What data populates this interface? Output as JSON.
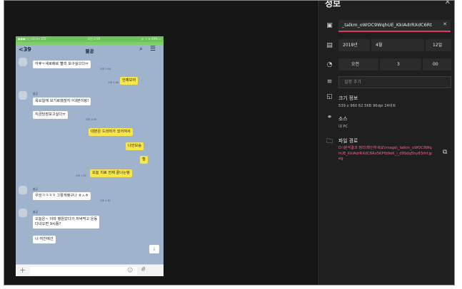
{
  "panel": {
    "title": "정보",
    "close_icon": "✕",
    "filename": "_talkm_oWOC9WqhUE_KkIAdrRXdC6Rt",
    "date": {
      "year": "2018년",
      "month": "4월",
      "day": "12일"
    },
    "time": {
      "ampm": "오전",
      "hour": "3",
      "minute": "00"
    },
    "description_placeholder": "설명 추가",
    "size_title": "크기 정보",
    "size_value": "539 x 960   62.5KB   96dpi   24비트",
    "source_title": "소스",
    "source_value": "내 PC",
    "path_title": "파일 경로",
    "path_value": "D:\\분석결과 정리\\확인하세요\\image\\_talkm_oWOC9WqhUE_KkIAdrRXdC6Rx5KPfb9eK_i_d9Sdq5hy83rhf.jpeg"
  },
  "phone": {
    "status_left": "●●●○○ LG U+  LTE",
    "status_center": "오전 2:59",
    "status_right": "◎ ⇪ ⊕ 40% ▭",
    "back_label": "39",
    "chat_title": "불공"
  },
  "messages": [
    {
      "side": "left",
      "text": "아후ㅜ새로배로 빨리 보구싶으다ㅠ",
      "time": "오후 1:48"
    },
    {
      "side": "right",
      "text": "언제보까",
      "time": "오후 1:48"
    },
    {
      "side": "left",
      "sender": "불공",
      "text": "목요일에 보기로했잖지ㅋ대본이랑!",
      "time": ""
    },
    {
      "side": "left",
      "text": "지금당장보고싶다ㅠ",
      "time": "오후 1:49"
    },
    {
      "side": "right",
      "text": "대본은 드라마가 있어져서",
      "time": ""
    },
    {
      "side": "right",
      "text": "나만보승",
      "time": ""
    },
    {
      "side": "right",
      "text": "헐",
      "time": ""
    },
    {
      "side": "right",
      "text": "오늘 치료 언제 끝나는뎅",
      "time": "오후 1:51"
    },
    {
      "side": "left",
      "sender": "불공",
      "text": "우앙ㅋㅋㅋㅋ 그렇게됏구나 ㅎㅅㅎ",
      "time": "오후 1:52"
    },
    {
      "side": "left",
      "sender": "불공",
      "text": "오늘은~ 이따 병원갔다가 저녁먹고 운동",
      "text2": "다녀오면 9시쯤?",
      "time": ""
    },
    {
      "side": "left",
      "text": "너 여친에선",
      "time": ""
    }
  ],
  "icons": {
    "name_field": "photo-icon",
    "date": "calendar-icon",
    "time": "clock-icon",
    "description": "list-icon",
    "size": "image-size-icon",
    "source": "link-icon",
    "path": "folder-icon",
    "copy": "copy-icon"
  }
}
